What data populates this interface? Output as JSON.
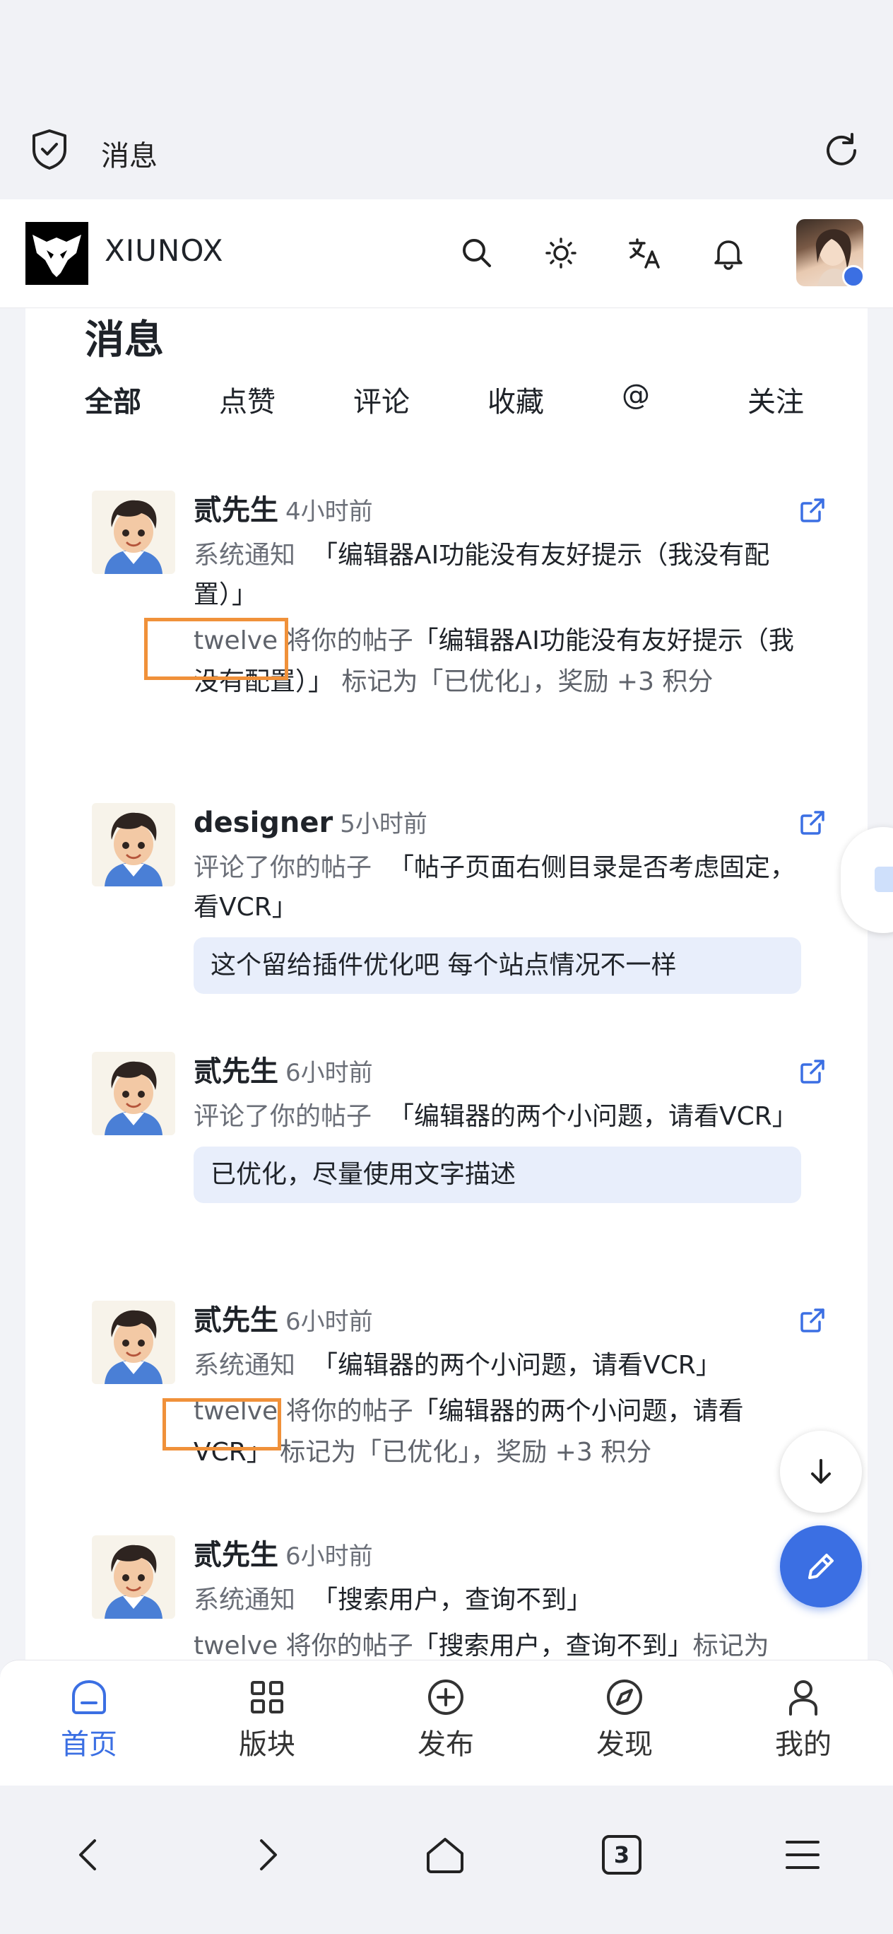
{
  "browser": {
    "tab_title": "消息",
    "tab_count": "3"
  },
  "site": {
    "brand": "XIUNOX"
  },
  "page": {
    "title": "消息",
    "tabs": [
      {
        "label": "全部",
        "active": true
      },
      {
        "label": "点赞",
        "active": false
      },
      {
        "label": "评论",
        "active": false
      },
      {
        "label": "收藏",
        "active": false
      },
      {
        "label": "@",
        "active": false
      },
      {
        "label": "关注",
        "active": false
      }
    ]
  },
  "messages": [
    {
      "name": "贰先生",
      "time": "4小时前",
      "kind": "系统通知",
      "ref": "「编辑器AI功能没有友好提示（我没有配置）」",
      "actor": "twelve",
      "text_pre": "将你的帖子",
      "text_ref": "「编辑器AI功能没有友好提示（我没有配置）」",
      "text_post": "标记为「已优化」，奖励 +3 积分"
    },
    {
      "name": "designer",
      "time": "5小时前",
      "kind": "评论了你的帖子",
      "ref": "「帖子页面右侧目录是否考虑固定，看VCR」",
      "reply": "这个留给插件优化吧 每个站点情况不一样"
    },
    {
      "name": "贰先生",
      "time": "6小时前",
      "kind": "评论了你的帖子",
      "ref": "「编辑器的两个小问题，请看VCR」",
      "reply": "已优化，尽量使用文字描述"
    },
    {
      "name": "贰先生",
      "time": "6小时前",
      "kind": "系统通知",
      "ref": "「编辑器的两个小问题，请看VCR」",
      "actor": "twelve",
      "text_pre": "将你的帖子",
      "text_ref": "「编辑器的两个小问题，请看VCR」",
      "text_post": "标记为「已优化」，奖励 +3 积分"
    },
    {
      "name": "贰先生",
      "time": "6小时前",
      "kind": "系统通知",
      "ref": "「搜索用户，查询不到」",
      "actor": "twelve",
      "text_pre": "将你的帖子",
      "text_ref": "「搜索用户，查询不到」",
      "text_post": "标记为"
    }
  ],
  "bottom_nav": [
    {
      "label": "首页",
      "icon": "home-icon",
      "active": true
    },
    {
      "label": "版块",
      "icon": "grid-icon",
      "active": false
    },
    {
      "label": "发布",
      "icon": "plus-circle-icon",
      "active": false
    },
    {
      "label": "发现",
      "icon": "compass-icon",
      "active": false
    },
    {
      "label": "我的",
      "icon": "user-icon",
      "active": false
    }
  ],
  "colors": {
    "accent": "#3b6fe3",
    "highlight": "#f0913a",
    "reply_bg": "#e8eefb"
  }
}
